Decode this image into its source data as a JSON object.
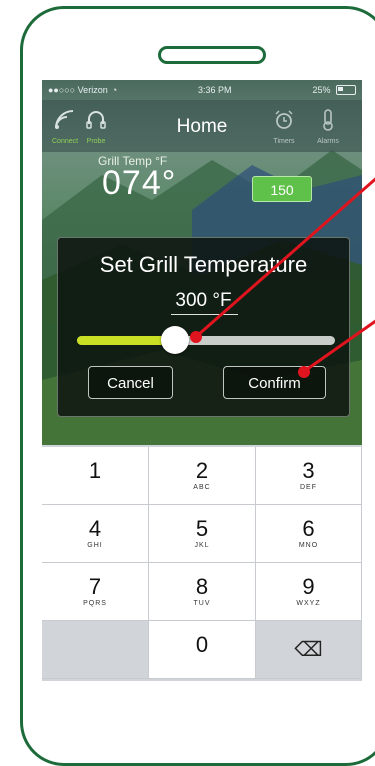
{
  "status_bar": {
    "carrier": "●●○○○ Verizon",
    "time": "3:36 PM",
    "battery": "25%"
  },
  "nav": {
    "title": "Home",
    "left_items": [
      {
        "icon": "wifi-signal-icon",
        "label": "Connect"
      },
      {
        "icon": "headset-icon",
        "label": "Probe"
      }
    ],
    "right_items": [
      {
        "icon": "alarm-clock-icon",
        "label": "Timers"
      },
      {
        "icon": "thermometer-icon",
        "label": "Alarms"
      }
    ]
  },
  "grill": {
    "temp_label": "Grill Temp °F",
    "current_temp": "074°",
    "set_temp": "150"
  },
  "dialog": {
    "title": "Set Grill Temperature",
    "value": "300 °F",
    "slider_fraction": 0.38,
    "cancel_label": "Cancel",
    "confirm_label": "Confirm"
  },
  "keypad": {
    "keys": [
      {
        "num": "1",
        "letters": ""
      },
      {
        "num": "2",
        "letters": "ABC"
      },
      {
        "num": "3",
        "letters": "DEF"
      },
      {
        "num": "4",
        "letters": "GHI"
      },
      {
        "num": "5",
        "letters": "JKL"
      },
      {
        "num": "6",
        "letters": "MNO"
      },
      {
        "num": "7",
        "letters": "PQRS"
      },
      {
        "num": "8",
        "letters": "TUV"
      },
      {
        "num": "9",
        "letters": "WXYZ"
      },
      {
        "num": "",
        "letters": ""
      },
      {
        "num": "0",
        "letters": ""
      },
      {
        "num": "⌫",
        "letters": ""
      }
    ]
  },
  "colors": {
    "frame": "#1d6b3a",
    "annotation": "#e0141e",
    "slider_fill": "#c9e024",
    "set_badge": "#5fc04a"
  }
}
